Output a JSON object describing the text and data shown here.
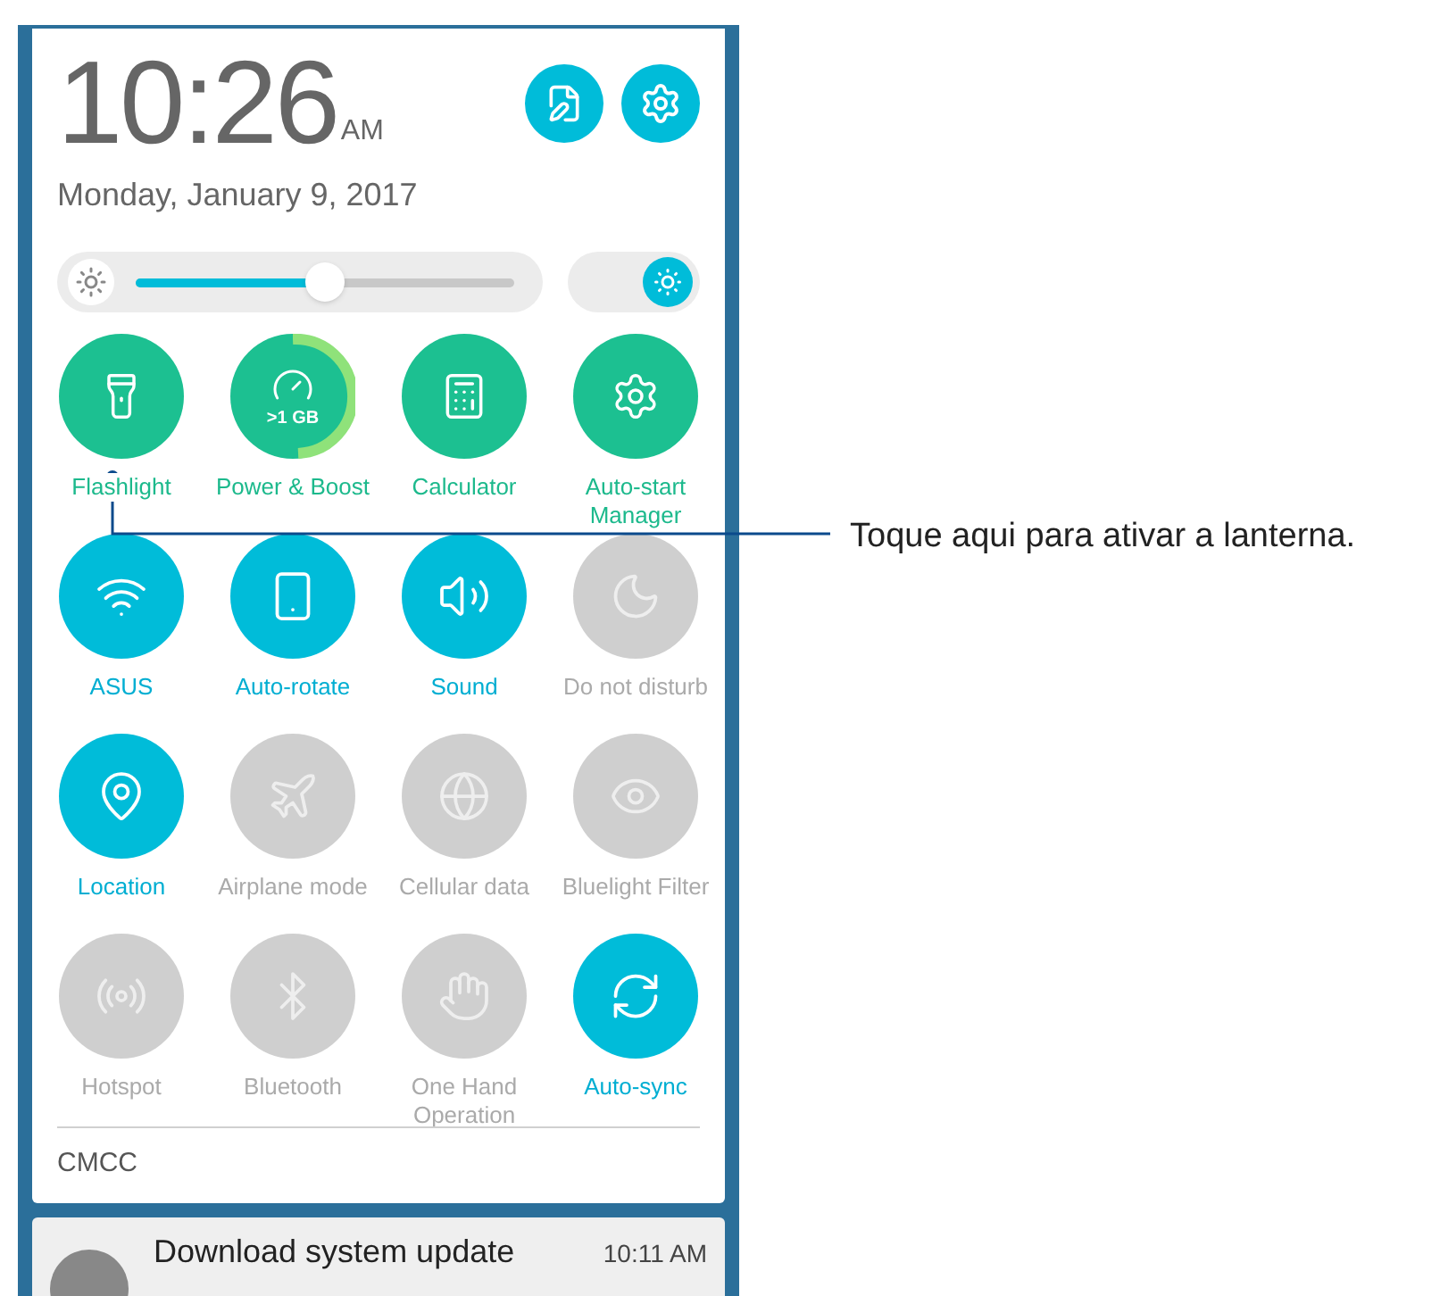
{
  "clock": {
    "time": "10:26",
    "ampm": "AM",
    "date": "Monday, January 9, 2017"
  },
  "brightness": {
    "level": 0.5,
    "auto": true
  },
  "shortcuts": [
    {
      "label": "Flashlight"
    },
    {
      "label": "Power & Boost",
      "badge": ">1 GB"
    },
    {
      "label": "Calculator"
    },
    {
      "label": "Auto-start Manager"
    }
  ],
  "toggles": [
    {
      "label": "ASUS",
      "on": true
    },
    {
      "label": "Auto-rotate",
      "on": true
    },
    {
      "label": "Sound",
      "on": true
    },
    {
      "label": "Do not disturb",
      "on": false
    },
    {
      "label": "Location",
      "on": true
    },
    {
      "label": "Airplane mode",
      "on": false
    },
    {
      "label": "Cellular data",
      "on": false
    },
    {
      "label": "Bluelight Filter",
      "on": false
    },
    {
      "label": "Hotspot",
      "on": false
    },
    {
      "label": "Bluetooth",
      "on": false
    },
    {
      "label": "One Hand Operation",
      "on": false
    },
    {
      "label": "Auto-sync",
      "on": true
    }
  ],
  "carrier": "CMCC",
  "notification": {
    "title": "Download system update",
    "time": "10:11 AM"
  },
  "callout": "Toque aqui para ativar a lanterna."
}
